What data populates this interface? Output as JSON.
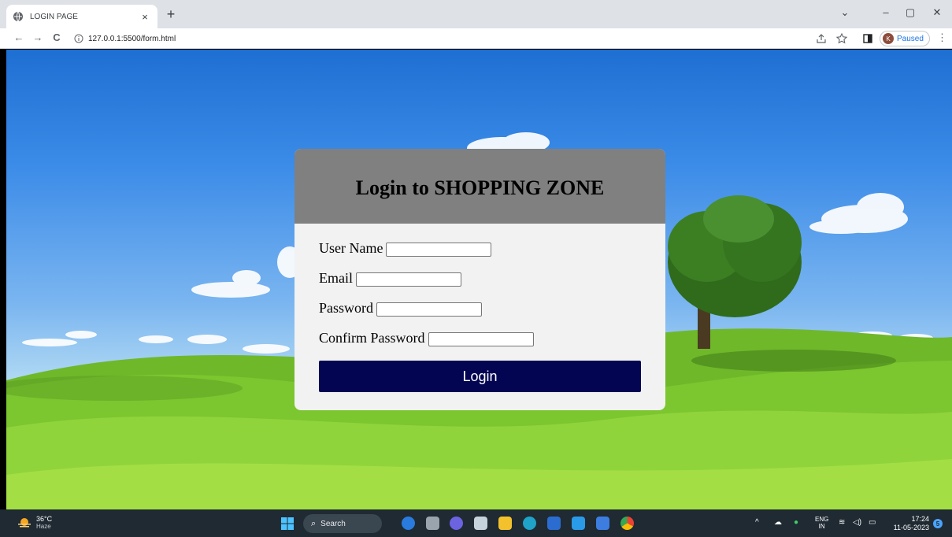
{
  "browser": {
    "tab_title": "LOGIN PAGE",
    "tab_close": "×",
    "new_tab": "+",
    "url": "127.0.0.1:5500/form.html",
    "profile_initial": "K",
    "profile_status": "Paused",
    "window_controls": {
      "tab_search": "⌄",
      "minimize": "–",
      "restore": "▢",
      "close": "✕"
    },
    "nav": {
      "back": "←",
      "forward": "→",
      "reload": "C"
    },
    "menu": "⋮"
  },
  "login": {
    "title": "Login to SHOPPING ZONE",
    "fields": {
      "username": {
        "label": "User Name",
        "value": ""
      },
      "email": {
        "label": "Email",
        "value": ""
      },
      "password": {
        "label": "Password",
        "value": ""
      },
      "confirm_password": {
        "label": "Confirm Password",
        "value": ""
      }
    },
    "submit_label": "Login"
  },
  "taskbar": {
    "weather": {
      "temp": "36°C",
      "condition": "Haze"
    },
    "search_label": "Search",
    "language_top": "ENG",
    "language_bottom": "IN",
    "time": "17:24",
    "date": "11-05-2023",
    "notification_count": "5"
  },
  "colors": {
    "header_bg": "#808080",
    "card_bg": "#f2f2f2",
    "button_bg": "#030552",
    "taskbar_bg": "#1f2a33"
  }
}
